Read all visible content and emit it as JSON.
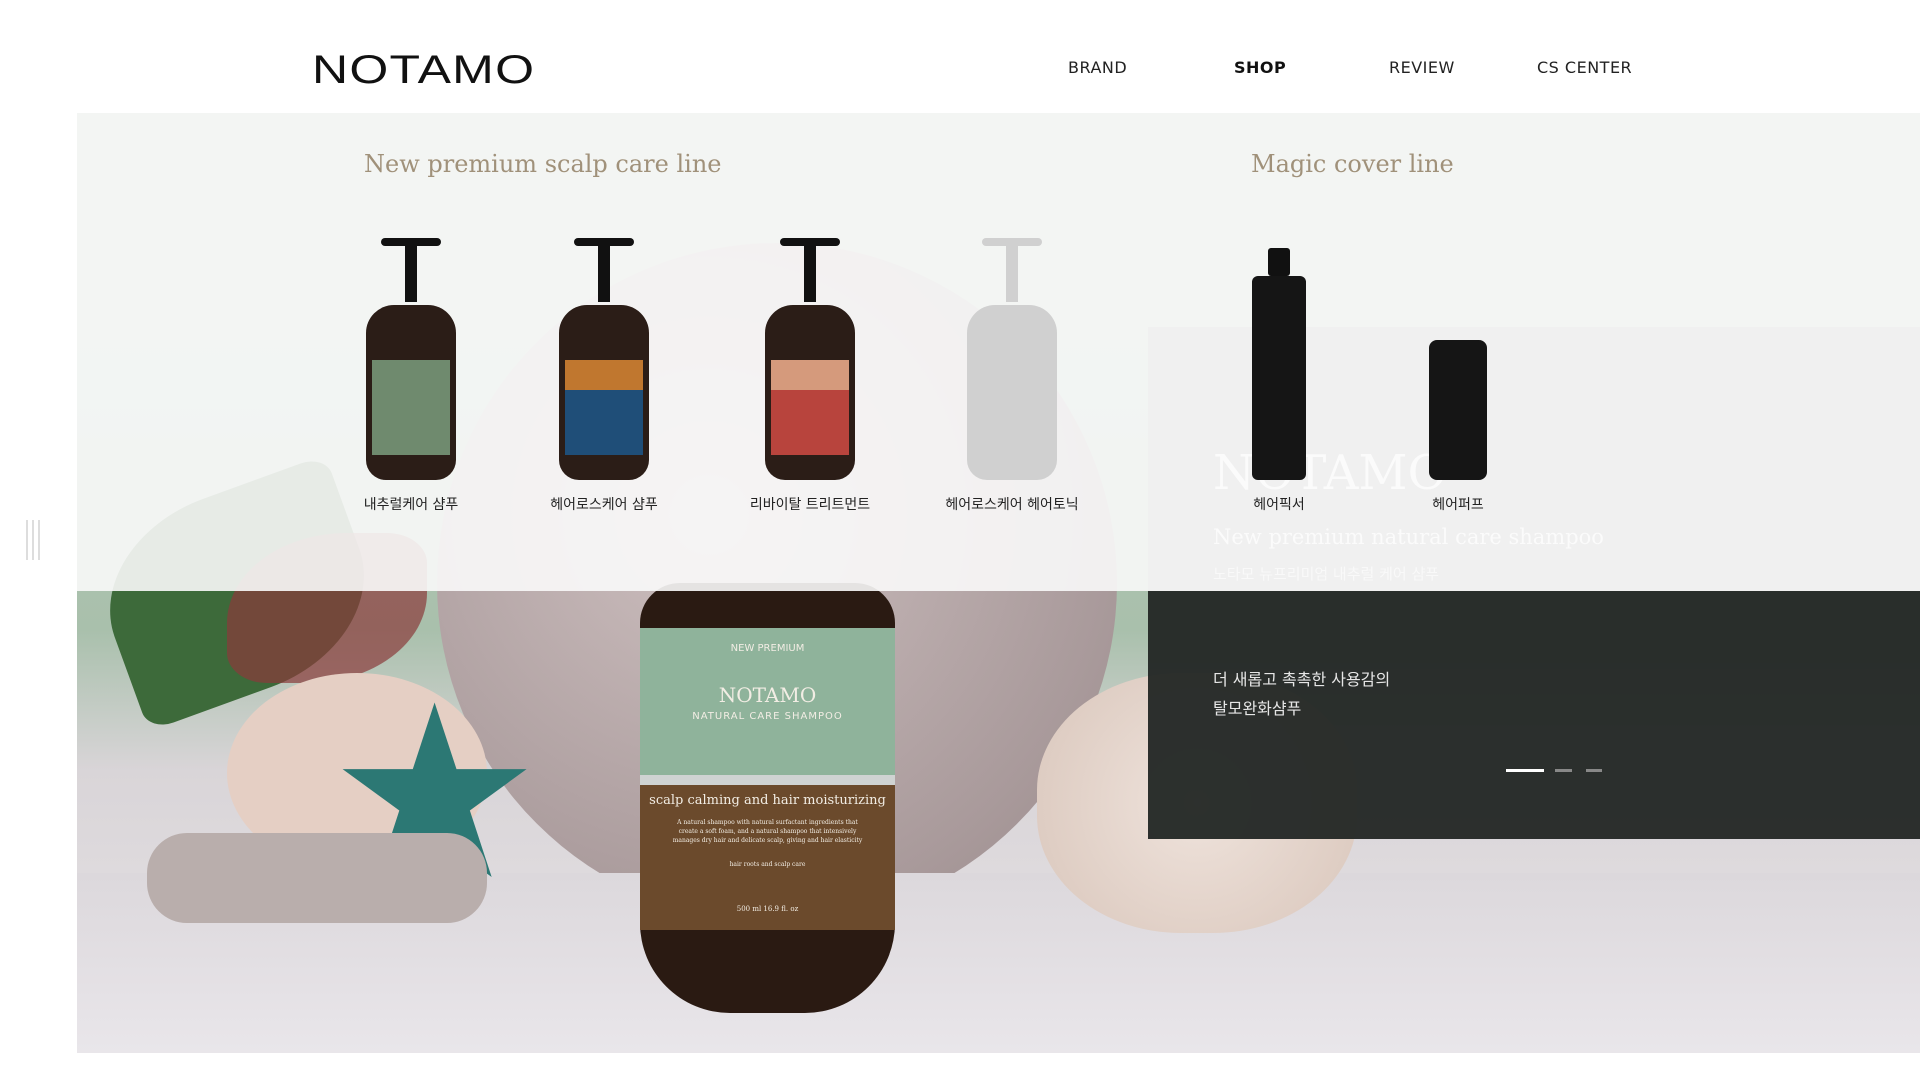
{
  "header": {
    "logo": "NOTAMO",
    "nav": [
      {
        "label": "BRAND"
      },
      {
        "label": "SHOP",
        "active": true
      },
      {
        "label": "REVIEW"
      },
      {
        "label": "CS CENTER"
      }
    ]
  },
  "menu": {
    "scalp_line": {
      "title": "New premium scalp care line",
      "products": [
        {
          "name": "내추럴케어 샴푸",
          "color": "#6f8a6e"
        },
        {
          "name": "헤어로스케어 샴푸",
          "color": "#1f4e78"
        },
        {
          "name": "리바이탈 트리트먼트",
          "color": "#b8443d"
        },
        {
          "name": "헤어로스케어 헤어토닉",
          "color": "#d0d0d0"
        }
      ]
    },
    "magic_line": {
      "title": "Magic cover line",
      "products": [
        {
          "name": "헤어픽서"
        },
        {
          "name": "헤어퍼프"
        }
      ]
    }
  },
  "hero": {
    "ghost_title": "NOTAMO",
    "ghost_subtitle": "New premium natural care shampoo",
    "ghost_korean": "노타모 뉴프리미엄 내추럴 케어 샴푸",
    "text_line1": "더 새롭고 촉촉한 사용감의",
    "text_line2": "탈모완화샴푸",
    "slide_count": 3,
    "active_slide": 1,
    "bottle": {
      "top": "NEW PREMIUM",
      "brand": "NOTAMO",
      "type": "NATURAL CARE SHAMPOO",
      "headline": "scalp calming and hair moisturizing",
      "desc": "A natural shampoo with natural surfactant ingredients that create a soft foam, and a natural shampoo that intensively manages dry hair and delicate scalp, giving and hair elasticity",
      "care": "hair roots and scalp care",
      "volume": "500 ml 16.9 fl. oz"
    }
  }
}
